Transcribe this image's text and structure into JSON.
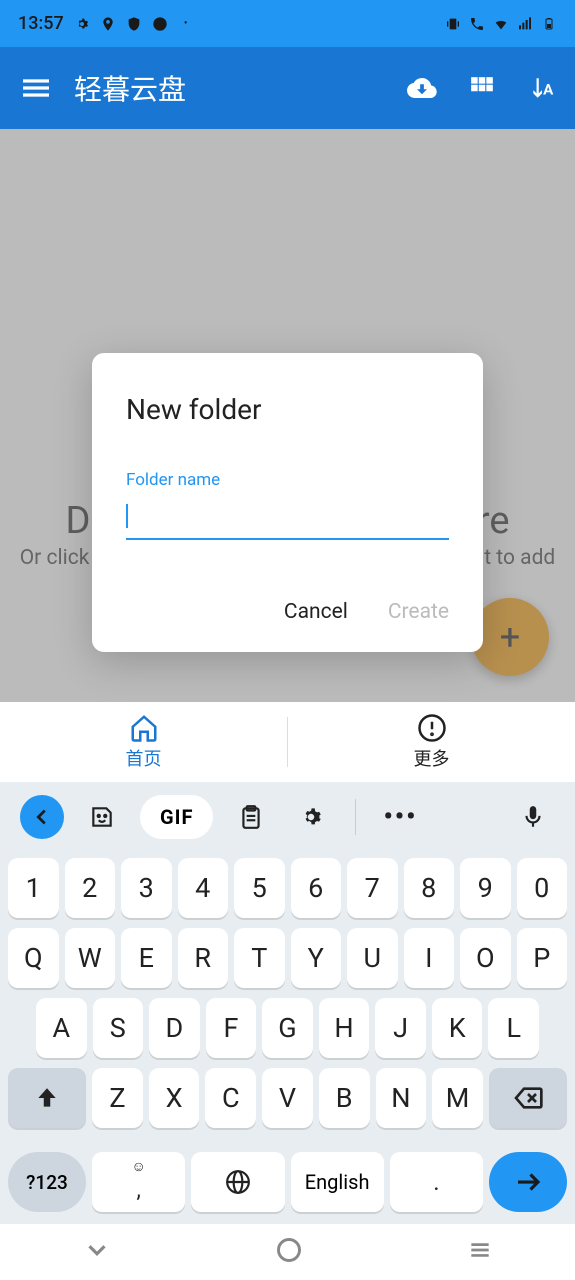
{
  "status": {
    "time": "13:57"
  },
  "header": {
    "title": "轻暮云盘"
  },
  "main": {
    "drop_line1": "Drag and drop the file here",
    "drop_line2": "Or click the \"Upload File\" button at the bottom right to add a file",
    "fab": "+"
  },
  "dialog": {
    "title": "New folder",
    "label": "Folder name",
    "value": "",
    "cancel": "Cancel",
    "create": "Create"
  },
  "nav": {
    "home": "首页",
    "more": "更多"
  },
  "keyboard": {
    "gif": "GIF",
    "space": "English",
    "sym": "?123",
    "comma": ",",
    "dot": ".",
    "row1": [
      "1",
      "2",
      "3",
      "4",
      "5",
      "6",
      "7",
      "8",
      "9",
      "0"
    ],
    "row2": [
      "Q",
      "W",
      "E",
      "R",
      "T",
      "Y",
      "U",
      "I",
      "O",
      "P"
    ],
    "row3": [
      "A",
      "S",
      "D",
      "F",
      "G",
      "H",
      "J",
      "K",
      "L"
    ],
    "row4": [
      "Z",
      "X",
      "C",
      "V",
      "B",
      "N",
      "M"
    ]
  }
}
